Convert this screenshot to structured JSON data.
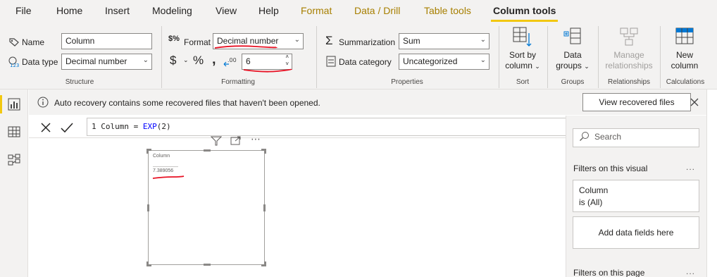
{
  "menu": {
    "items": [
      "File",
      "Home",
      "Insert",
      "Modeling",
      "View",
      "Help",
      "Format",
      "Data / Drill",
      "Table tools",
      "Column tools"
    ]
  },
  "ribbon": {
    "structure": {
      "name_label": "Name",
      "name_value": "Column",
      "datatype_label": "Data type",
      "datatype_value": "Decimal number",
      "group_label": "Structure"
    },
    "formatting": {
      "format_label": "Format",
      "format_value": "Decimal number",
      "currency_symbol": "$",
      "percent_symbol": "%",
      "comma_symbol": "‚",
      "decimals_value": "6",
      "group_label": "Formatting"
    },
    "properties": {
      "summarization_label": "Summarization",
      "summarization_value": "Sum",
      "category_label": "Data category",
      "category_value": "Uncategorized",
      "group_label": "Properties"
    },
    "sort": {
      "button_line1": "Sort by",
      "button_line2": "column",
      "group_label": "Sort"
    },
    "groups": {
      "button_line1": "Data",
      "button_line2": "groups",
      "group_label": "Groups"
    },
    "relationships": {
      "button_line1": "Manage",
      "button_line2": "relationships",
      "group_label": "Relationships"
    },
    "calculations": {
      "button_line1": "New",
      "button_line2": "column",
      "group_label": "Calculations"
    }
  },
  "notification": {
    "message": "Auto recovery contains some recovered files that haven't been opened.",
    "button": "View recovered files"
  },
  "formula": {
    "line_number": "1",
    "text_before": " Column = ",
    "function": "EXP",
    "args": "(2)"
  },
  "visual": {
    "title": "Column",
    "value": "7.389056"
  },
  "filters": {
    "search_placeholder": "Search",
    "on_visual_heading": "Filters on this visual",
    "card_field": "Column",
    "card_state": "is (All)",
    "add_fields": "Add data fields here",
    "on_page_heading": "Filters on this page",
    "more": "..."
  },
  "colors": {
    "accent_yellow": "#f2c811",
    "context_tab": "#a77f00",
    "annotation_red": "#e81123"
  }
}
